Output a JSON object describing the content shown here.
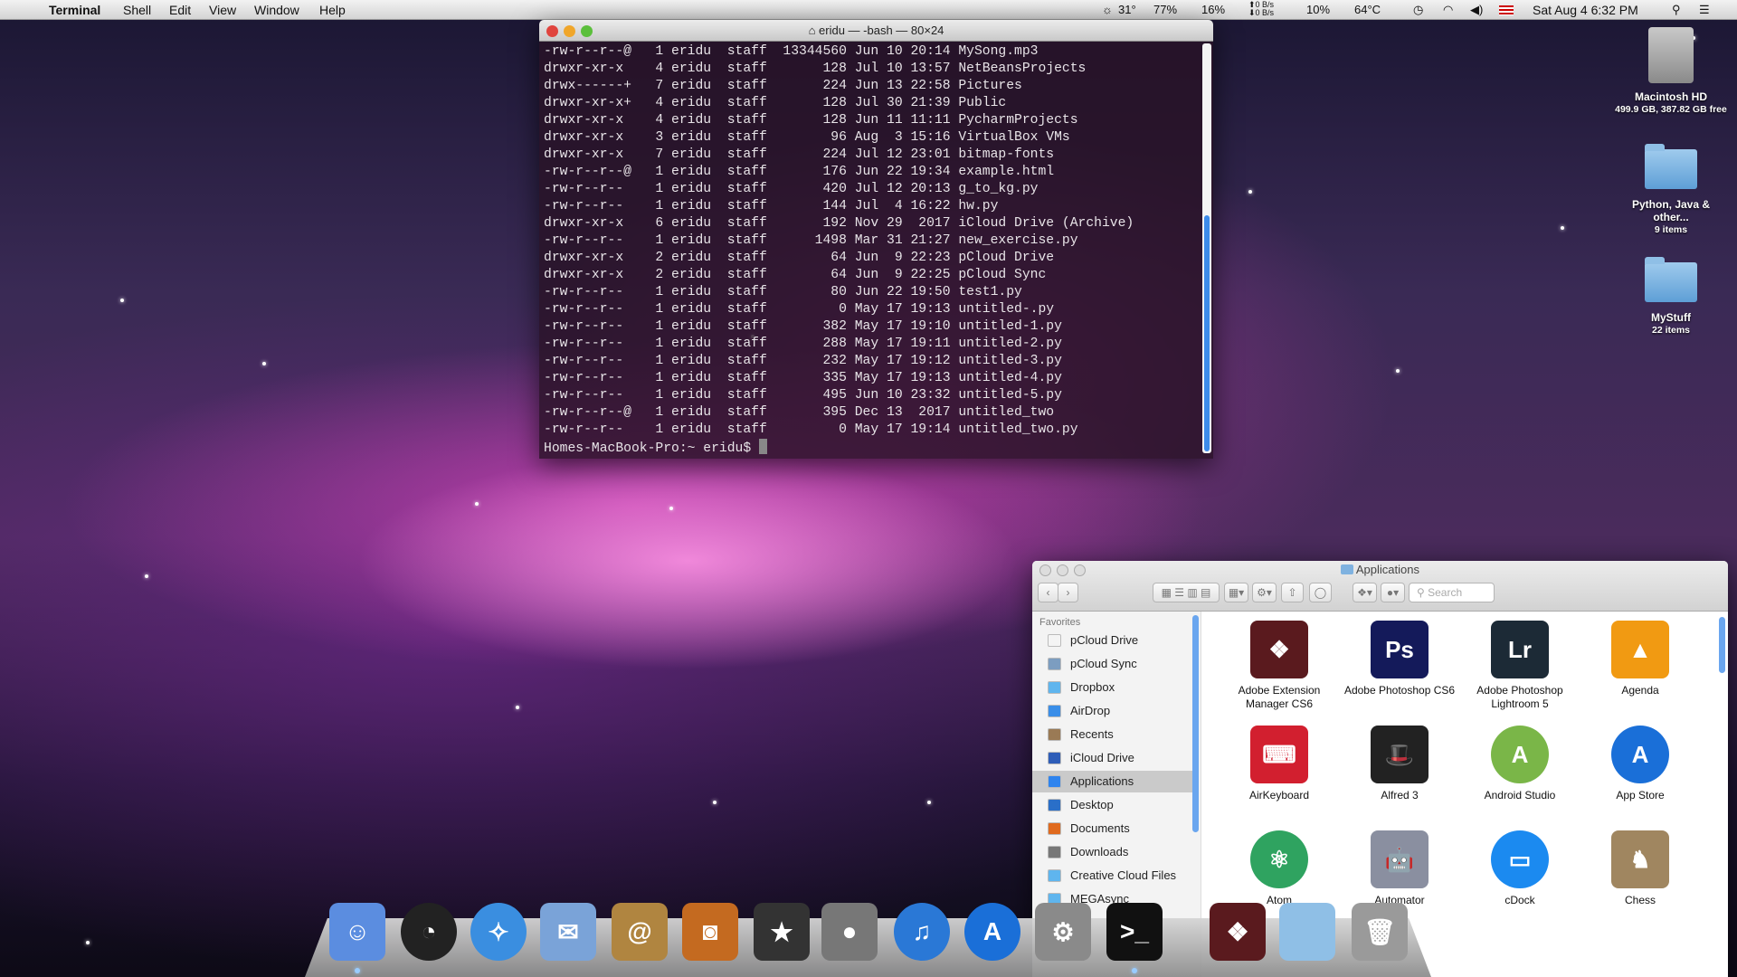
{
  "menubar": {
    "app": "Terminal",
    "items": [
      "Shell",
      "Edit",
      "View",
      "Window",
      "Help"
    ],
    "status": {
      "weather": "31°",
      "disk": "77%",
      "mem": "16%",
      "net_up": "0 B/s",
      "net_down": "0 B/s",
      "cpu": "10%",
      "temp": "64°C",
      "datetime": "Sat Aug 4  6:32 PM"
    }
  },
  "terminal": {
    "title": "eridu — -bash — 80×24",
    "lines": [
      "-rw-r--r--@   1 eridu  staff  13344560 Jun 10 20:14 MySong.mp3",
      "drwxr-xr-x    4 eridu  staff       128 Jul 10 13:57 NetBeansProjects",
      "drwx------+   7 eridu  staff       224 Jun 13 22:58 Pictures",
      "drwxr-xr-x+   4 eridu  staff       128 Jul 30 21:39 Public",
      "drwxr-xr-x    4 eridu  staff       128 Jun 11 11:11 PycharmProjects",
      "drwxr-xr-x    3 eridu  staff        96 Aug  3 15:16 VirtualBox VMs",
      "drwxr-xr-x    7 eridu  staff       224 Jul 12 23:01 bitmap-fonts",
      "-rw-r--r--@   1 eridu  staff       176 Jun 22 19:34 example.html",
      "-rw-r--r--    1 eridu  staff       420 Jul 12 20:13 g_to_kg.py",
      "-rw-r--r--    1 eridu  staff       144 Jul  4 16:22 hw.py",
      "drwxr-xr-x    6 eridu  staff       192 Nov 29  2017 iCloud Drive (Archive)",
      "-rw-r--r--    1 eridu  staff      1498 Mar 31 21:27 new_exercise.py",
      "drwxr-xr-x    2 eridu  staff        64 Jun  9 22:23 pCloud Drive",
      "drwxr-xr-x    2 eridu  staff        64 Jun  9 22:25 pCloud Sync",
      "-rw-r--r--    1 eridu  staff        80 Jun 22 19:50 test1.py",
      "-rw-r--r--    1 eridu  staff         0 May 17 19:13 untitled-.py",
      "-rw-r--r--    1 eridu  staff       382 May 17 19:10 untitled-1.py",
      "-rw-r--r--    1 eridu  staff       288 May 17 19:11 untitled-2.py",
      "-rw-r--r--    1 eridu  staff       232 May 17 19:12 untitled-3.py",
      "-rw-r--r--    1 eridu  staff       335 May 17 19:13 untitled-4.py",
      "-rw-r--r--    1 eridu  staff       495 Jun 10 23:32 untitled-5.py",
      "-rw-r--r--@   1 eridu  staff       395 Dec 13  2017 untitled_two",
      "-rw-r--r--    1 eridu  staff         0 May 17 19:14 untitled_two.py"
    ],
    "prompt": "Homes-MacBook-Pro:~ eridu$ "
  },
  "finder": {
    "title": "Applications",
    "search_placeholder": "Search",
    "sidebar_heading": "Favorites",
    "sidebar": [
      {
        "label": "pCloud Drive",
        "color": "#f4f4f4"
      },
      {
        "label": "pCloud Sync",
        "color": "#7c9dc0"
      },
      {
        "label": "Dropbox",
        "color": "#5fb5ee"
      },
      {
        "label": "AirDrop",
        "color": "#3a8ee8"
      },
      {
        "label": "Recents",
        "color": "#9a7a55"
      },
      {
        "label": "iCloud Drive",
        "color": "#2e5db8"
      },
      {
        "label": "Applications",
        "color": "#2f84ee",
        "selected": true
      },
      {
        "label": "Desktop",
        "color": "#2a6fc8"
      },
      {
        "label": "Documents",
        "color": "#e06a1e"
      },
      {
        "label": "Downloads",
        "color": "#777777"
      },
      {
        "label": "Creative Cloud Files",
        "color": "#5fb5ee"
      },
      {
        "label": "MEGAsync",
        "color": "#5fb5ee"
      }
    ],
    "apps": [
      {
        "name": "Adobe Extension Manager CS6",
        "glyph": "❖",
        "color": "#5a1a1e"
      },
      {
        "name": "Adobe Photoshop CS6",
        "glyph": "Ps",
        "color": "#141a5a"
      },
      {
        "name": "Adobe Photoshop Lightroom 5",
        "glyph": "Lr",
        "color": "#1c2a36"
      },
      {
        "name": "Agenda",
        "glyph": "▲",
        "color": "#f19a12"
      },
      {
        "name": "AirKeyboard",
        "glyph": "⌨",
        "color": "#d21f2f"
      },
      {
        "name": "Alfred 3",
        "glyph": "🎩",
        "color": "#222222"
      },
      {
        "name": "Android Studio",
        "glyph": "A",
        "color": "#7ab648"
      },
      {
        "name": "App Store",
        "glyph": "A",
        "color": "#1a6fd8"
      },
      {
        "name": "Atom",
        "glyph": "⚛",
        "color": "#2fa360"
      },
      {
        "name": "Automator",
        "glyph": "🤖",
        "color": "#8a8fa0"
      },
      {
        "name": "cDock",
        "glyph": "▭",
        "color": "#1b8af0"
      },
      {
        "name": "Chess",
        "glyph": "♞",
        "color": "#a08660"
      }
    ]
  },
  "desktop": [
    {
      "name": "Macintosh HD",
      "sub": "499.9 GB, 387.82 GB free",
      "type": "drive"
    },
    {
      "name": "Python, Java & other...",
      "sub": "9 items",
      "type": "folder"
    },
    {
      "name": "MyStuff",
      "sub": "22 items",
      "type": "folder"
    }
  ],
  "dock": [
    {
      "name": "finder",
      "glyph": "☺",
      "color": "#5b8de0"
    },
    {
      "name": "dashboard",
      "glyph": "◔",
      "color": "#222"
    },
    {
      "name": "safari",
      "glyph": "✧",
      "color": "#3a8ee0"
    },
    {
      "name": "mail",
      "glyph": "✉",
      "color": "#7aa3d8"
    },
    {
      "name": "address-book",
      "glyph": "@",
      "color": "#b08540"
    },
    {
      "name": "iphoto",
      "glyph": "◙",
      "color": "#c46a20"
    },
    {
      "name": "imovie",
      "glyph": "★",
      "color": "#333"
    },
    {
      "name": "facetime",
      "glyph": "●",
      "color": "#777"
    },
    {
      "name": "itunes",
      "glyph": "♫",
      "color": "#2a78d6"
    },
    {
      "name": "app-store",
      "glyph": "A",
      "color": "#1a6fd8"
    },
    {
      "name": "system-preferences",
      "glyph": "⚙",
      "color": "#8a8a8a"
    },
    {
      "name": "terminal",
      "glyph": ">_",
      "color": "#111"
    },
    {
      "name": "adobe-extension-stack",
      "glyph": "❖",
      "color": "#5a1a1e"
    },
    {
      "name": "documents-stack",
      "glyph": "",
      "color": "#8fbfe6"
    },
    {
      "name": "trash",
      "glyph": "🗑",
      "color": "#9a9a9a"
    }
  ]
}
